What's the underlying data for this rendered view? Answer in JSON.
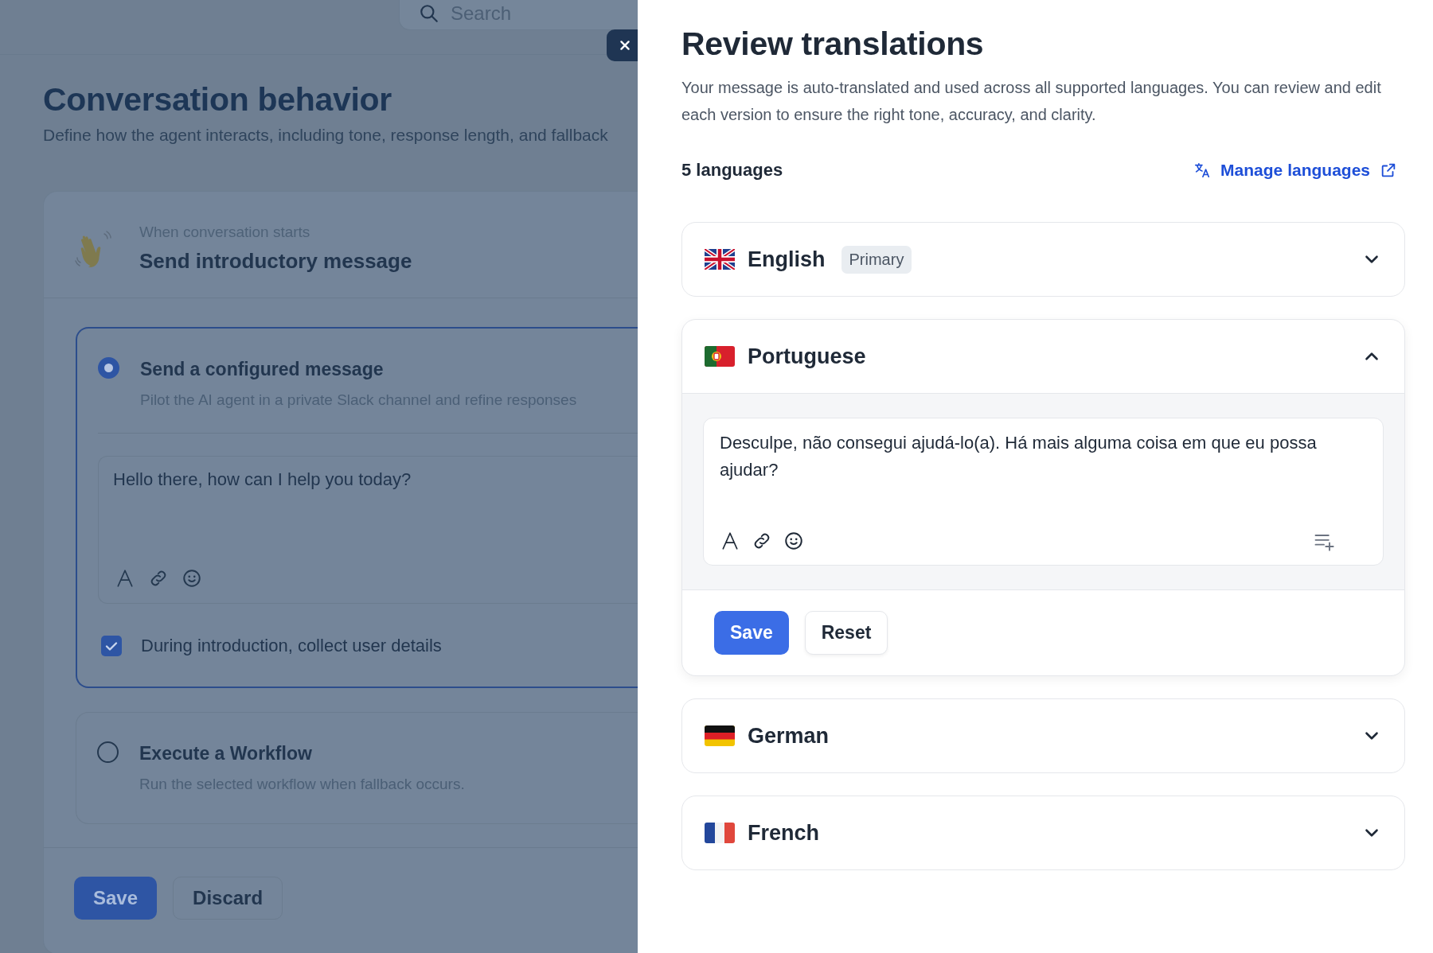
{
  "search": {
    "placeholder": "Search"
  },
  "page": {
    "title": "Conversation behavior",
    "subtitle": "Define how the agent interacts, including tone, response length, and fallback"
  },
  "intro_card": {
    "overline": "When conversation starts",
    "title": "Send introductory message"
  },
  "options": [
    {
      "title": "Send a configured message",
      "description": "Pilot the AI agent in a private Slack channel and refine responses",
      "selected": true,
      "message": "Hello there, how can I help you today?",
      "collect": {
        "label": "During introduction, collect user details",
        "checked": true
      }
    },
    {
      "title": "Execute a Workflow",
      "description": "Run the selected workflow when fallback occurs.",
      "selected": false
    }
  ],
  "footer_buttons": [
    "Save",
    "Discard"
  ],
  "panel": {
    "title": "Review translations",
    "description": "Your message is auto-translated and used across all supported languages. You can review and edit each version to ensure the right tone, accuracy, and clarity.",
    "count": "5 languages",
    "manage_link": "Manage languages",
    "languages": [
      {
        "kind": "gb",
        "name": "English",
        "badge": "Primary",
        "expanded": false
      },
      {
        "kind": "pt",
        "name": "Portuguese",
        "expanded": true,
        "text": "Desculpe, não consegui ajudá-lo(a). Há mais alguma coisa em que eu possa ajudar?",
        "buttons": [
          "Save",
          "Reset"
        ]
      },
      {
        "kind": "de",
        "name": "German",
        "expanded": false
      },
      {
        "kind": "fr",
        "name": "French",
        "expanded": false
      }
    ]
  }
}
